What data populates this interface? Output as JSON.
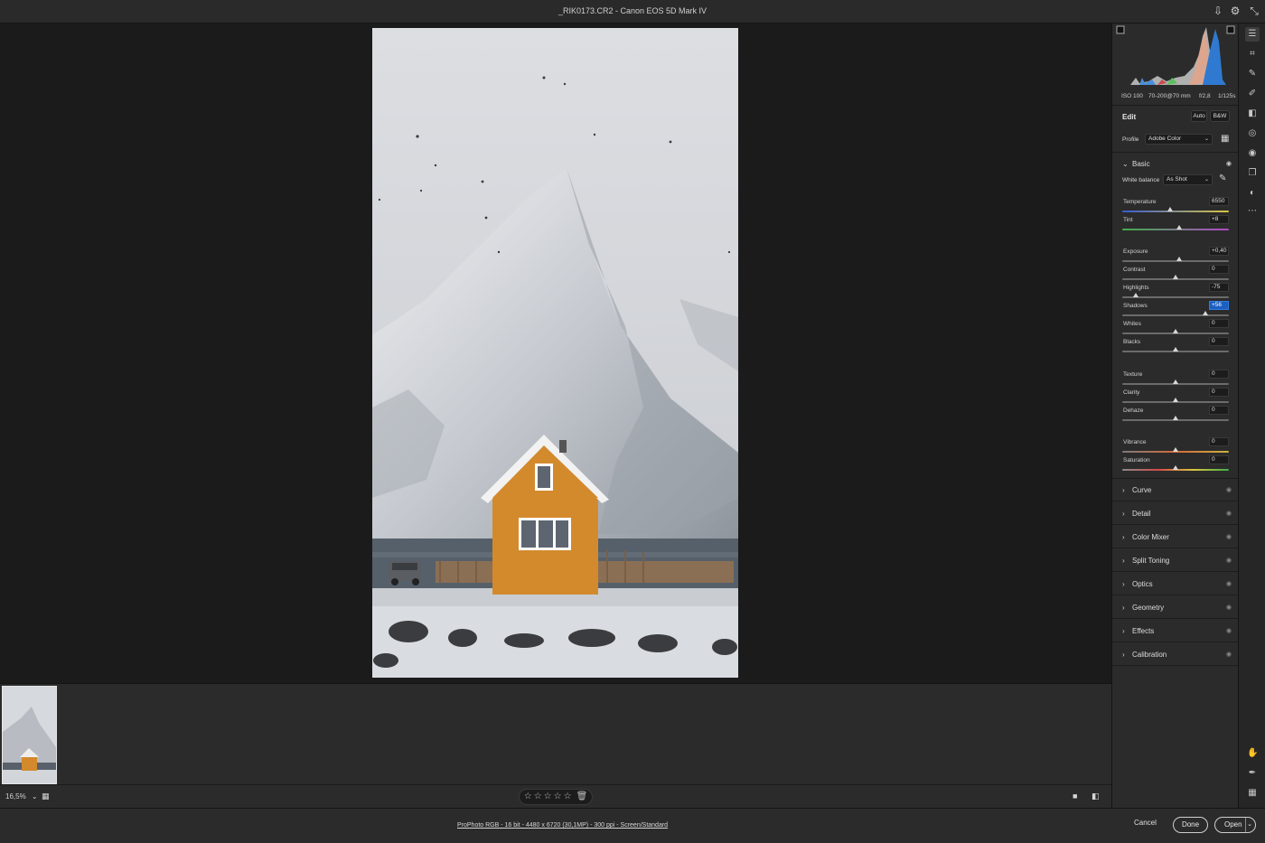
{
  "window": {
    "title": "_RIK0173.CR2  -  Canon EOS 5D Mark IV"
  },
  "titlebar_icons": [
    "save-icon",
    "gear-icon",
    "collapse-icon"
  ],
  "exif": {
    "iso": "ISO 100",
    "lens": "70-200@70 mm",
    "aperture": "f/2,8",
    "shutter": "1/125s"
  },
  "edit": {
    "title": "Edit",
    "auto_label": "Auto",
    "bw_label": "B&W",
    "profile_label": "Profile",
    "profile_value": "Adobe Color",
    "basic_label": "Basic",
    "white_balance_label": "White balance",
    "white_balance_value": "As Shot"
  },
  "sliders": [
    {
      "label": "Temperature",
      "value": "6550",
      "position": 0.45,
      "gradient": "temp"
    },
    {
      "label": "Tint",
      "value": "+8",
      "position": 0.53,
      "gradient": "tint"
    },
    {
      "label": "Exposure",
      "value": "+0,40",
      "position": 0.53
    },
    {
      "label": "Contrast",
      "value": "0",
      "position": 0.5
    },
    {
      "label": "Highlights",
      "value": "-75",
      "position": 0.13
    },
    {
      "label": "Shadows",
      "value": "+56",
      "position": 0.78,
      "selected": true
    },
    {
      "label": "Whites",
      "value": "0",
      "position": 0.5
    },
    {
      "label": "Blacks",
      "value": "0",
      "position": 0.5
    },
    {
      "label": "Texture",
      "value": "0",
      "position": 0.5
    },
    {
      "label": "Clarity",
      "value": "0",
      "position": 0.5
    },
    {
      "label": "Dehaze",
      "value": "0",
      "position": 0.5
    },
    {
      "label": "Vibrance",
      "value": "0",
      "position": 0.5,
      "gradient": "vib"
    },
    {
      "label": "Saturation",
      "value": "0",
      "position": 0.5,
      "gradient": "sat"
    }
  ],
  "sections": [
    "Curve",
    "Detail",
    "Color Mixer",
    "Split Toning",
    "Optics",
    "Geometry",
    "Effects",
    "Calibration"
  ],
  "bottombar": {
    "zoom": "16,5%"
  },
  "footer": {
    "info": "ProPhoto RGB - 16 bit - 4480 x 6720 (30,1MP) - 300 ppi - Screen/Standard",
    "cancel": "Cancel",
    "done": "Done",
    "open": "Open"
  },
  "colors": {
    "panel": "#2b2b2b",
    "canvas": "#1b1b1b",
    "selection": "#1d5fbf"
  },
  "rail_icons": [
    "edit-sliders-icon",
    "crop-icon",
    "healing-icon",
    "brush-icon",
    "gradient-icon",
    "radial-icon",
    "redeye-icon",
    "presets-icon",
    "masking-icon",
    "more-icon"
  ]
}
